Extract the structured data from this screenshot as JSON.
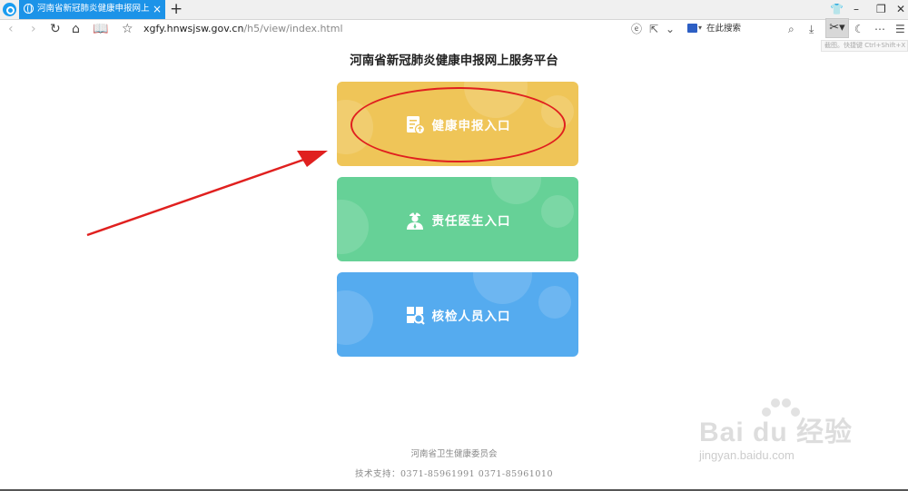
{
  "browser": {
    "tab_title": "河南省新冠肺炎健康申报网上服务平",
    "tab_close": "×",
    "new_tab": "+",
    "url_host": "xgfy.hnwsjsw.gov.cn",
    "url_path": "/h5/view/index.html",
    "search_placeholder": "在此搜索",
    "tooltip": "截图。快捷键 Ctrl+Shift+X",
    "window_controls": {
      "minimize": "–",
      "restore": "❐",
      "close": "✕"
    }
  },
  "page": {
    "title": "河南省新冠肺炎健康申报网上服务平台",
    "cards": [
      {
        "label": "健康申报入口",
        "icon": "document-upload-icon",
        "color": "#efc558"
      },
      {
        "label": "责任医生入口",
        "icon": "doctor-icon",
        "color": "#66d197"
      },
      {
        "label": "核检人员入口",
        "icon": "search-inspect-icon",
        "color": "#55abef"
      }
    ],
    "footer_org": "河南省卫生健康委员会",
    "footer_support": "技术支持：0371-85961991   0371-85961010"
  },
  "annotation": {
    "arrow_color": "#e0201f",
    "oval_color": "#e0201f"
  },
  "watermark": {
    "brand": "Bai du 经验",
    "site": "jingyan.baidu.com"
  }
}
